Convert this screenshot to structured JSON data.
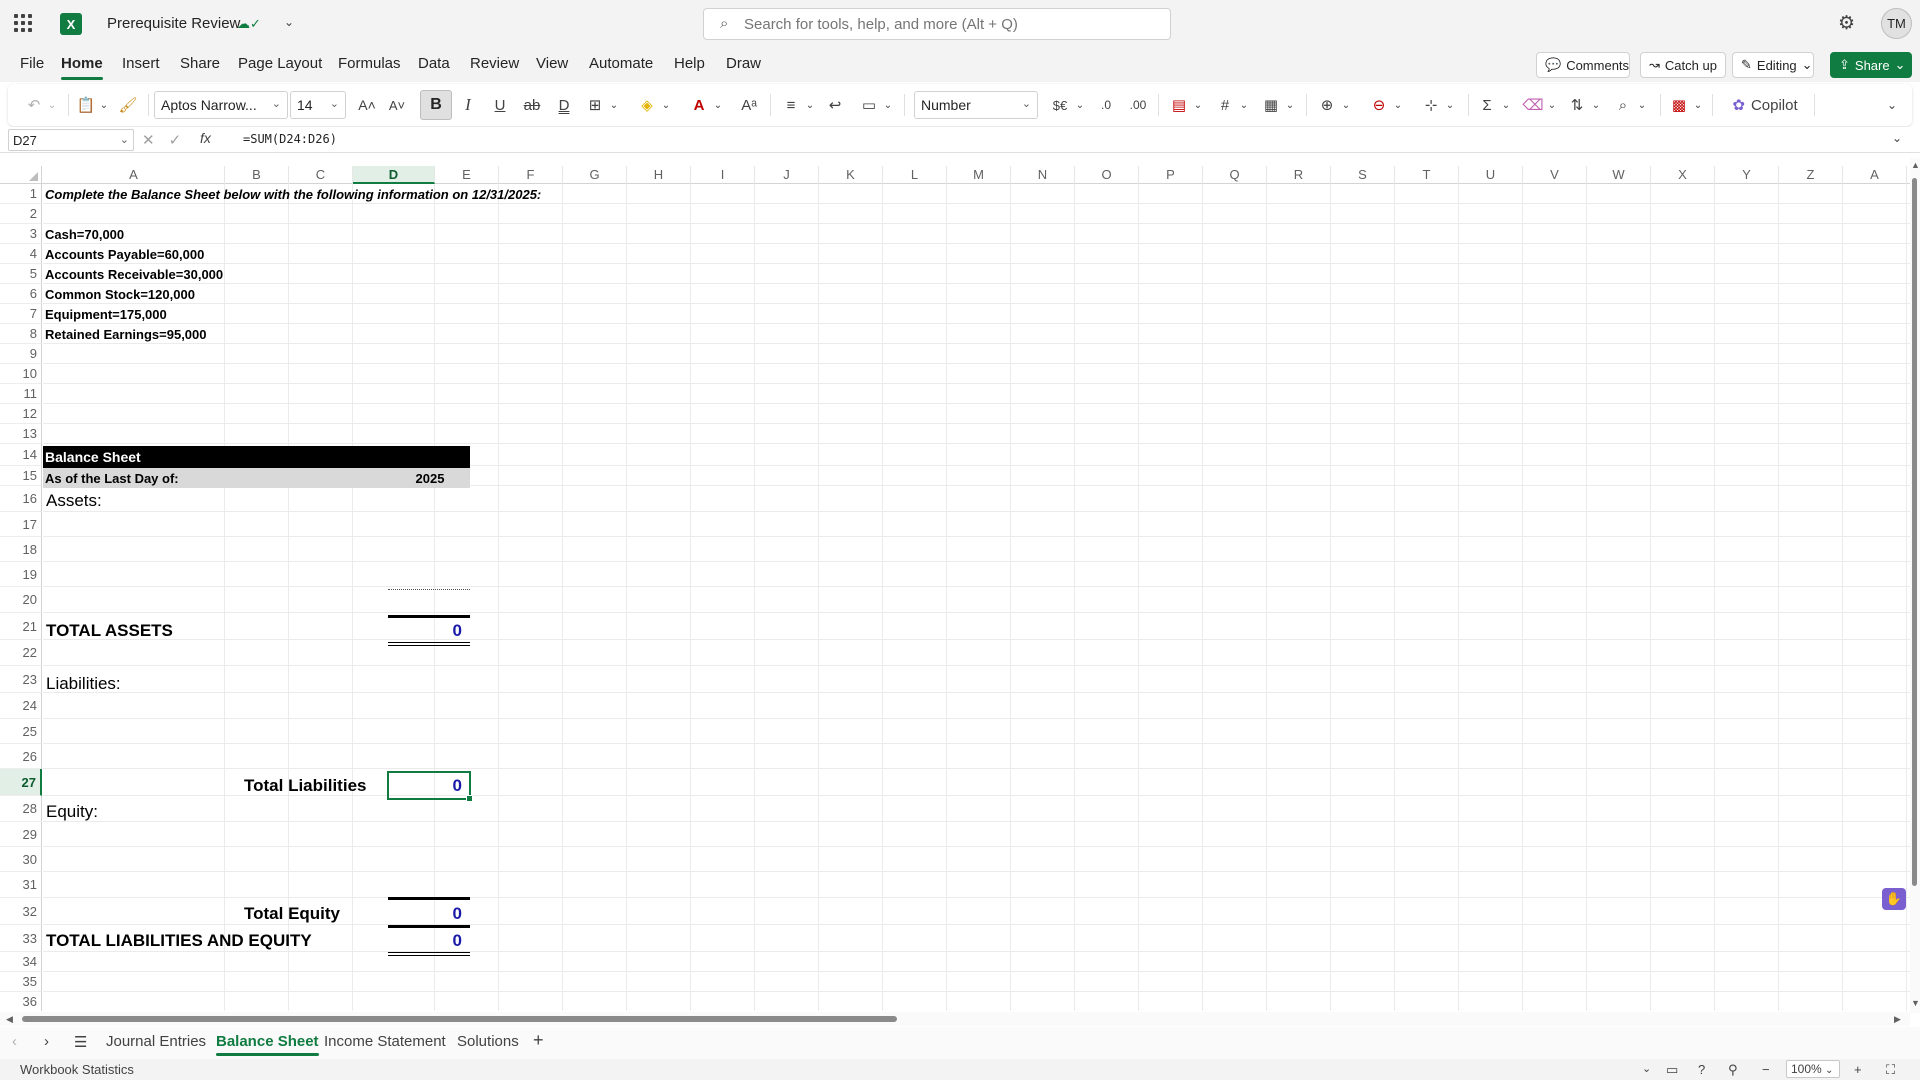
{
  "titlebar": {
    "doc_title": "Prerequisite Review",
    "search_placeholder": "Search for tools, help, and more (Alt + Q)",
    "user_initials": "TM"
  },
  "menu": {
    "tabs": [
      "File",
      "Home",
      "Insert",
      "Share",
      "Page Layout",
      "Formulas",
      "Data",
      "Review",
      "View",
      "Automate",
      "Help",
      "Draw"
    ],
    "active": "Home",
    "comments": "Comments",
    "catchup": "Catch up",
    "editing": "Editing",
    "share": "Share"
  },
  "ribbon": {
    "font_name": "Aptos Narrow...",
    "font_size": "14",
    "number_format": "Number",
    "copilot": "Copilot"
  },
  "formula_bar": {
    "name_box": "D27",
    "fx": "fx",
    "formula": "=SUM(D24:D26)"
  },
  "columns": [
    "A",
    "B",
    "C",
    "D",
    "E",
    "F",
    "G",
    "H",
    "I",
    "J",
    "K",
    "L",
    "M",
    "N",
    "O",
    "P",
    "Q",
    "R",
    "S",
    "T",
    "U",
    "V",
    "W",
    "X",
    "Y",
    "Z",
    "A"
  ],
  "rows": [
    "1",
    "2",
    "3",
    "4",
    "5",
    "6",
    "7",
    "8",
    "9",
    "10",
    "11",
    "12",
    "13",
    "14",
    "15",
    "16",
    "17",
    "18",
    "19",
    "20",
    "21",
    "22",
    "23",
    "24",
    "25",
    "26",
    "27",
    "28",
    "29",
    "30",
    "31",
    "32",
    "33",
    "34",
    "35",
    "36"
  ],
  "sheet": {
    "instruction": "Complete the Balance Sheet below with the following information on 12/31/2025:",
    "given": [
      "Cash=70,000",
      "Accounts Payable=60,000",
      "Accounts Receivable=30,000",
      "Common Stock=120,000",
      "Equipment=175,000",
      "Retained Earnings=95,000"
    ],
    "bs_title": "Balance Sheet",
    "as_of": "As of the Last Day of:",
    "year": "2025",
    "assets": "Assets:",
    "total_assets": "TOTAL ASSETS",
    "total_assets_value": "0",
    "liabilities": "Liabilities:",
    "total_liabilities": "Total Liabilities",
    "total_liabilities_value": "0",
    "equity": "Equity:",
    "total_equity": "Total Equity",
    "total_equity_value": "0",
    "total_le": "TOTAL LIABILITIES AND EQUITY",
    "total_le_value": "0"
  },
  "sheet_tabs": [
    "Journal Entries",
    "Balance Sheet",
    "Income Statement",
    "Solutions"
  ],
  "active_sheet": "Balance Sheet",
  "status": {
    "workbook_stats": "Workbook Statistics",
    "zoom": "100%"
  },
  "colors": {
    "accent": "#107c41",
    "value_blue": "#1a1aa8"
  }
}
